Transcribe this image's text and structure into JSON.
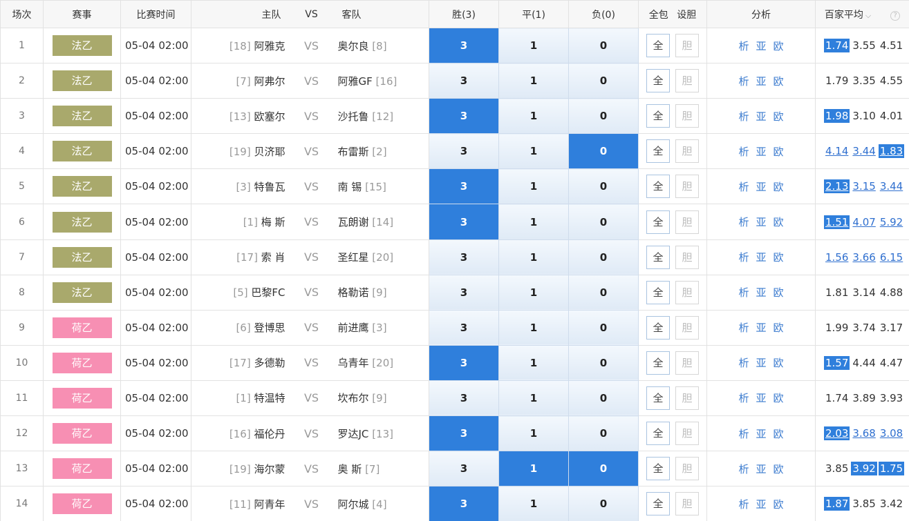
{
  "header": {
    "num": "场次",
    "league": "赛事",
    "time": "比赛时间",
    "home": "主队",
    "vs": "VS",
    "away": "客队",
    "win": "胜(3)",
    "draw": "平(1)",
    "lose": "负(0)",
    "all": "全包",
    "dan": "设胆",
    "analysis": "分析",
    "odds": "百家平均",
    "odds_chevron": "⌵",
    "help": "?"
  },
  "labels": {
    "all": "全",
    "dan": "胆",
    "xi": "析",
    "ya": "亚",
    "ou": "欧",
    "pick3": "3",
    "pick1": "1",
    "pick0": "0"
  },
  "colors": {
    "ligue2": "#a9a96c",
    "eredivisie": "#f78fb3",
    "selected": "#2f7fdc"
  },
  "rows": [
    {
      "num": "1",
      "league": "法乙",
      "lc": "ligue2",
      "time": "05-04 02:00",
      "hr": "[18]",
      "home": "阿雅克",
      "away": "奥尔良",
      "ar": "[8]",
      "sel": [
        true,
        false,
        false
      ],
      "odds": [
        {
          "v": "1.74",
          "hl": true,
          "u": false
        },
        {
          "v": "3.55",
          "hl": false,
          "u": false
        },
        {
          "v": "4.51",
          "hl": false,
          "u": false
        }
      ]
    },
    {
      "num": "2",
      "league": "法乙",
      "lc": "ligue2",
      "time": "05-04 02:00",
      "hr": "[7]",
      "home": "阿弗尔",
      "away": "阿雅GF",
      "ar": "[16]",
      "sel": [
        false,
        false,
        false
      ],
      "odds": [
        {
          "v": "1.79",
          "hl": false,
          "u": false
        },
        {
          "v": "3.35",
          "hl": false,
          "u": false
        },
        {
          "v": "4.55",
          "hl": false,
          "u": false
        }
      ]
    },
    {
      "num": "3",
      "league": "法乙",
      "lc": "ligue2",
      "time": "05-04 02:00",
      "hr": "[13]",
      "home": "欧塞尔",
      "away": "沙托鲁",
      "ar": "[12]",
      "sel": [
        true,
        false,
        false
      ],
      "odds": [
        {
          "v": "1.98",
          "hl": true,
          "u": false
        },
        {
          "v": "3.10",
          "hl": false,
          "u": false
        },
        {
          "v": "4.01",
          "hl": false,
          "u": false
        }
      ]
    },
    {
      "num": "4",
      "league": "法乙",
      "lc": "ligue2",
      "time": "05-04 02:00",
      "hr": "[19]",
      "home": "贝济耶",
      "away": "布雷斯",
      "ar": "[2]",
      "sel": [
        false,
        false,
        true
      ],
      "odds": [
        {
          "v": "4.14",
          "hl": false,
          "u": true
        },
        {
          "v": "3.44",
          "hl": false,
          "u": true
        },
        {
          "v": "1.83",
          "hl": true,
          "u": true
        }
      ]
    },
    {
      "num": "5",
      "league": "法乙",
      "lc": "ligue2",
      "time": "05-04 02:00",
      "hr": "[3]",
      "home": "特鲁瓦",
      "away": "南 锡",
      "ar": "[15]",
      "sel": [
        true,
        false,
        false
      ],
      "odds": [
        {
          "v": "2.13",
          "hl": true,
          "u": true
        },
        {
          "v": "3.15",
          "hl": false,
          "u": true
        },
        {
          "v": "3.44",
          "hl": false,
          "u": true
        }
      ]
    },
    {
      "num": "6",
      "league": "法乙",
      "lc": "ligue2",
      "time": "05-04 02:00",
      "hr": "[1]",
      "home": "梅 斯",
      "away": "瓦朗谢",
      "ar": "[14]",
      "sel": [
        true,
        false,
        false
      ],
      "odds": [
        {
          "v": "1.51",
          "hl": true,
          "u": true
        },
        {
          "v": "4.07",
          "hl": false,
          "u": true
        },
        {
          "v": "5.92",
          "hl": false,
          "u": true
        }
      ]
    },
    {
      "num": "7",
      "league": "法乙",
      "lc": "ligue2",
      "time": "05-04 02:00",
      "hr": "[17]",
      "home": "索 肖",
      "away": "圣红星",
      "ar": "[20]",
      "sel": [
        false,
        false,
        false
      ],
      "odds": [
        {
          "v": "1.56",
          "hl": false,
          "u": true
        },
        {
          "v": "3.66",
          "hl": false,
          "u": true
        },
        {
          "v": "6.15",
          "hl": false,
          "u": true
        }
      ]
    },
    {
      "num": "8",
      "league": "法乙",
      "lc": "ligue2",
      "time": "05-04 02:00",
      "hr": "[5]",
      "home": "巴黎FC",
      "away": "格勒诺",
      "ar": "[9]",
      "sel": [
        false,
        false,
        false
      ],
      "odds": [
        {
          "v": "1.81",
          "hl": false,
          "u": false
        },
        {
          "v": "3.14",
          "hl": false,
          "u": false
        },
        {
          "v": "4.88",
          "hl": false,
          "u": false
        }
      ]
    },
    {
      "num": "9",
      "league": "荷乙",
      "lc": "eredivisie",
      "time": "05-04 02:00",
      "hr": "[6]",
      "home": "登博思",
      "away": "前进鹰",
      "ar": "[3]",
      "sel": [
        false,
        false,
        false
      ],
      "odds": [
        {
          "v": "1.99",
          "hl": false,
          "u": false
        },
        {
          "v": "3.74",
          "hl": false,
          "u": false
        },
        {
          "v": "3.17",
          "hl": false,
          "u": false
        }
      ]
    },
    {
      "num": "10",
      "league": "荷乙",
      "lc": "eredivisie",
      "time": "05-04 02:00",
      "hr": "[17]",
      "home": "多德勒",
      "away": "乌青年",
      "ar": "[20]",
      "sel": [
        true,
        false,
        false
      ],
      "odds": [
        {
          "v": "1.57",
          "hl": true,
          "u": false
        },
        {
          "v": "4.44",
          "hl": false,
          "u": false
        },
        {
          "v": "4.47",
          "hl": false,
          "u": false
        }
      ]
    },
    {
      "num": "11",
      "league": "荷乙",
      "lc": "eredivisie",
      "time": "05-04 02:00",
      "hr": "[1]",
      "home": "特温特",
      "away": "坎布尔",
      "ar": "[9]",
      "sel": [
        false,
        false,
        false
      ],
      "odds": [
        {
          "v": "1.74",
          "hl": false,
          "u": false
        },
        {
          "v": "3.89",
          "hl": false,
          "u": false
        },
        {
          "v": "3.93",
          "hl": false,
          "u": false
        }
      ]
    },
    {
      "num": "12",
      "league": "荷乙",
      "lc": "eredivisie",
      "time": "05-04 02:00",
      "hr": "[16]",
      "home": "福伦丹",
      "away": "罗达JC",
      "ar": "[13]",
      "sel": [
        true,
        false,
        false
      ],
      "odds": [
        {
          "v": "2.03",
          "hl": true,
          "u": true
        },
        {
          "v": "3.68",
          "hl": false,
          "u": true
        },
        {
          "v": "3.08",
          "hl": false,
          "u": true
        }
      ]
    },
    {
      "num": "13",
      "league": "荷乙",
      "lc": "eredivisie",
      "time": "05-04 02:00",
      "hr": "[19]",
      "home": "海尔蒙",
      "away": "奥 斯",
      "ar": "[7]",
      "sel": [
        false,
        true,
        true
      ],
      "odds": [
        {
          "v": "3.85",
          "hl": false,
          "u": false
        },
        {
          "v": "3.92",
          "hl": true,
          "u": false
        },
        {
          "v": "1.75",
          "hl": true,
          "u": false
        }
      ]
    },
    {
      "num": "14",
      "league": "荷乙",
      "lc": "eredivisie",
      "time": "05-04 02:00",
      "hr": "[11]",
      "home": "阿青年",
      "away": "阿尔城",
      "ar": "[4]",
      "sel": [
        true,
        false,
        false
      ],
      "odds": [
        {
          "v": "1.87",
          "hl": true,
          "u": false
        },
        {
          "v": "3.85",
          "hl": false,
          "u": false
        },
        {
          "v": "3.42",
          "hl": false,
          "u": false
        }
      ]
    }
  ]
}
